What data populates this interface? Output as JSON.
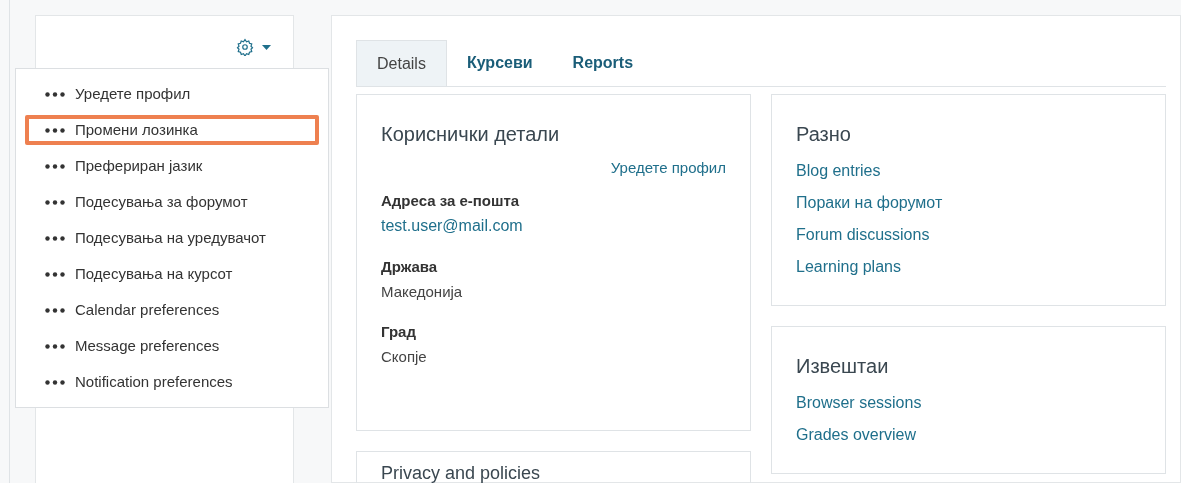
{
  "user_menu": {
    "items": [
      {
        "label": "Уредете профил",
        "highlighted": false
      },
      {
        "label": "Промени лозинка",
        "highlighted": true
      },
      {
        "label": "Префериран јазик",
        "highlighted": false
      },
      {
        "label": "Подесувања за форумот",
        "highlighted": false
      },
      {
        "label": "Подесувања на уредувачот",
        "highlighted": false
      },
      {
        "label": "Подесувања на курсот",
        "highlighted": false
      },
      {
        "label": "Calendar preferences",
        "highlighted": false
      },
      {
        "label": "Message preferences",
        "highlighted": false
      },
      {
        "label": "Notification preferences",
        "highlighted": false
      }
    ]
  },
  "tabs": [
    {
      "label": "Details",
      "selected": true
    },
    {
      "label": "Курсеви",
      "selected": false
    },
    {
      "label": "Reports",
      "selected": false
    }
  ],
  "user_details": {
    "title": "Кориснички детали",
    "edit_link": "Уредете профил",
    "fields": [
      {
        "label": "Адреса за е-пошта",
        "value": "test.user@mail.com",
        "kind": "link"
      },
      {
        "label": "Држава",
        "value": "Македонија",
        "kind": "text"
      },
      {
        "label": "Град",
        "value": "Скопје",
        "kind": "text"
      }
    ]
  },
  "privacy_card": {
    "title": "Privacy and policies"
  },
  "misc": {
    "title": "Разно",
    "links": [
      "Blog entries",
      "Пораки на форумот",
      "Forum discussions",
      "Learning plans"
    ]
  },
  "reports": {
    "title": "Извештаи",
    "links": [
      "Browser sessions",
      "Grades overview"
    ]
  }
}
